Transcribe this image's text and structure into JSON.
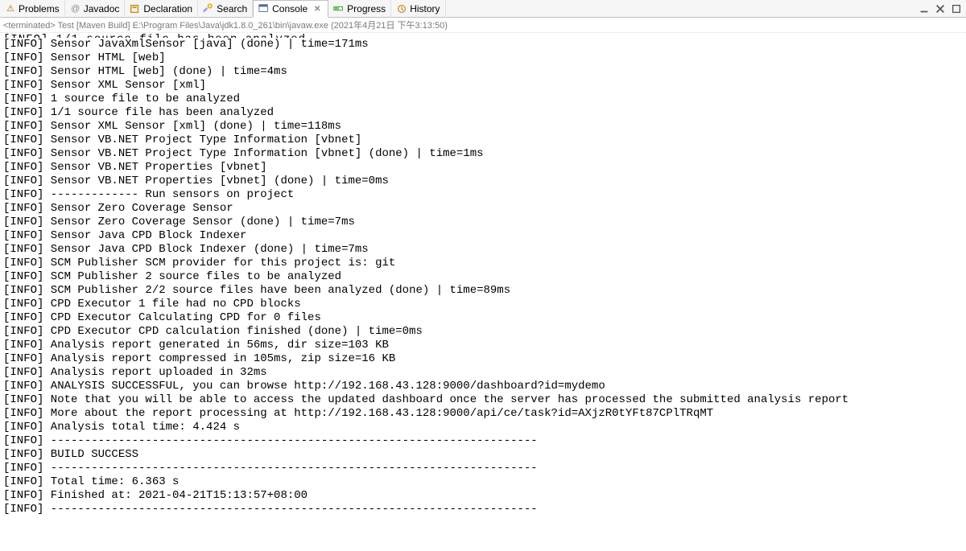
{
  "tabs": {
    "problems": {
      "label": "Problems"
    },
    "javadoc": {
      "label": "Javadoc"
    },
    "declaration": {
      "label": "Declaration"
    },
    "search": {
      "label": "Search"
    },
    "console": {
      "label": "Console"
    },
    "progress": {
      "label": "Progress"
    },
    "history": {
      "label": "History"
    }
  },
  "status": {
    "line": "<terminated> Test [Maven Build] E:\\Program Files\\Java\\jdk1.8.0_261\\bin\\javaw.exe (2021年4月21日 下午3:13:50)"
  },
  "console_lines": [
    "[INFO] Sensor JavaXmlSensor [java] (done) | time=171ms",
    "[INFO] Sensor HTML [web]",
    "[INFO] Sensor HTML [web] (done) | time=4ms",
    "[INFO] Sensor XML Sensor [xml]",
    "[INFO] 1 source file to be analyzed",
    "[INFO] 1/1 source file has been analyzed",
    "[INFO] Sensor XML Sensor [xml] (done) | time=118ms",
    "[INFO] Sensor VB.NET Project Type Information [vbnet]",
    "[INFO] Sensor VB.NET Project Type Information [vbnet] (done) | time=1ms",
    "[INFO] Sensor VB.NET Properties [vbnet]",
    "[INFO] Sensor VB.NET Properties [vbnet] (done) | time=0ms",
    "[INFO] ------------- Run sensors on project",
    "[INFO] Sensor Zero Coverage Sensor",
    "[INFO] Sensor Zero Coverage Sensor (done) | time=7ms",
    "[INFO] Sensor Java CPD Block Indexer",
    "[INFO] Sensor Java CPD Block Indexer (done) | time=7ms",
    "[INFO] SCM Publisher SCM provider for this project is: git",
    "[INFO] SCM Publisher 2 source files to be analyzed",
    "[INFO] SCM Publisher 2/2 source files have been analyzed (done) | time=89ms",
    "[INFO] CPD Executor 1 file had no CPD blocks",
    "[INFO] CPD Executor Calculating CPD for 0 files",
    "[INFO] CPD Executor CPD calculation finished (done) | time=0ms",
    "[INFO] Analysis report generated in 56ms, dir size=103 KB",
    "[INFO] Analysis report compressed in 105ms, zip size=16 KB",
    "[INFO] Analysis report uploaded in 32ms",
    "[INFO] ANALYSIS SUCCESSFUL, you can browse http://192.168.43.128:9000/dashboard?id=mydemo",
    "[INFO] Note that you will be able to access the updated dashboard once the server has processed the submitted analysis report",
    "[INFO] More about the report processing at http://192.168.43.128:9000/api/ce/task?id=AXjzR0tYFt87CPlTRqMT",
    "[INFO] Analysis total time: 4.424 s",
    "[INFO] ------------------------------------------------------------------------",
    "[INFO] BUILD SUCCESS",
    "[INFO] ------------------------------------------------------------------------",
    "[INFO] Total time: 6.363 s",
    "[INFO] Finished at: 2021-04-21T15:13:57+08:00",
    "[INFO] ------------------------------------------------------------------------"
  ]
}
